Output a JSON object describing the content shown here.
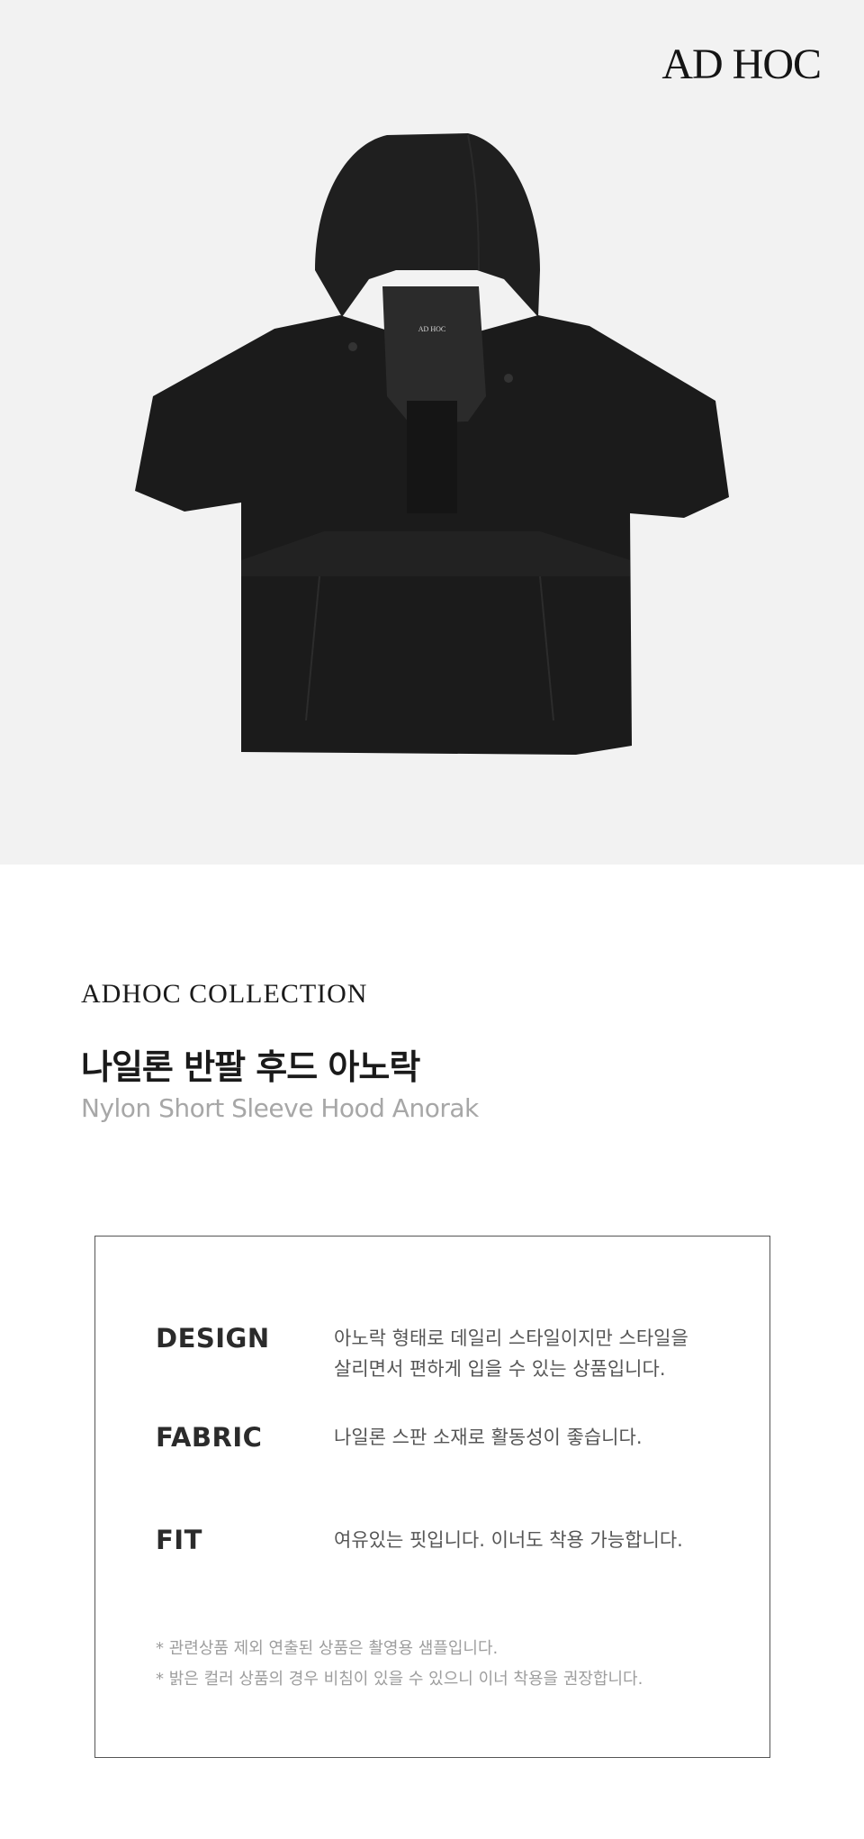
{
  "brand": {
    "logo_text": "AD HOC"
  },
  "hero": {
    "image_alt": "black nylon short sleeve hooded anorak",
    "label_text": "AD HOC"
  },
  "product": {
    "collection": "ADHOC COLLECTION",
    "name_ko": "나일론 반팔 후드 아노락",
    "name_en": "Nylon Short Sleeve Hood Anorak"
  },
  "specs": [
    {
      "label": "DESIGN",
      "lines": [
        "아노락 형태로 데일리 스타일이지만 스타일을",
        "살리면서 편하게 입을 수 있는 상품입니다."
      ]
    },
    {
      "label": "FABRIC",
      "lines": [
        "나일론 스판 소재로 활동성이 좋습니다."
      ]
    },
    {
      "label": "FIT",
      "lines": [
        "여유있는 핏입니다. 이너도 착용 가능합니다."
      ]
    }
  ],
  "notes": [
    "* 관련상품 제외 연출된 상품은 촬영용 샘플입니다.",
    "* 밝은 컬러 상품의 경우 비침이 있을 수 있으니 이너 착용을 권장합니다."
  ],
  "colors": {
    "hero_bg": "#f2f2f2",
    "garment": "#1b1b1b",
    "muted_text": "#a7a7a7",
    "border": "#555555"
  }
}
